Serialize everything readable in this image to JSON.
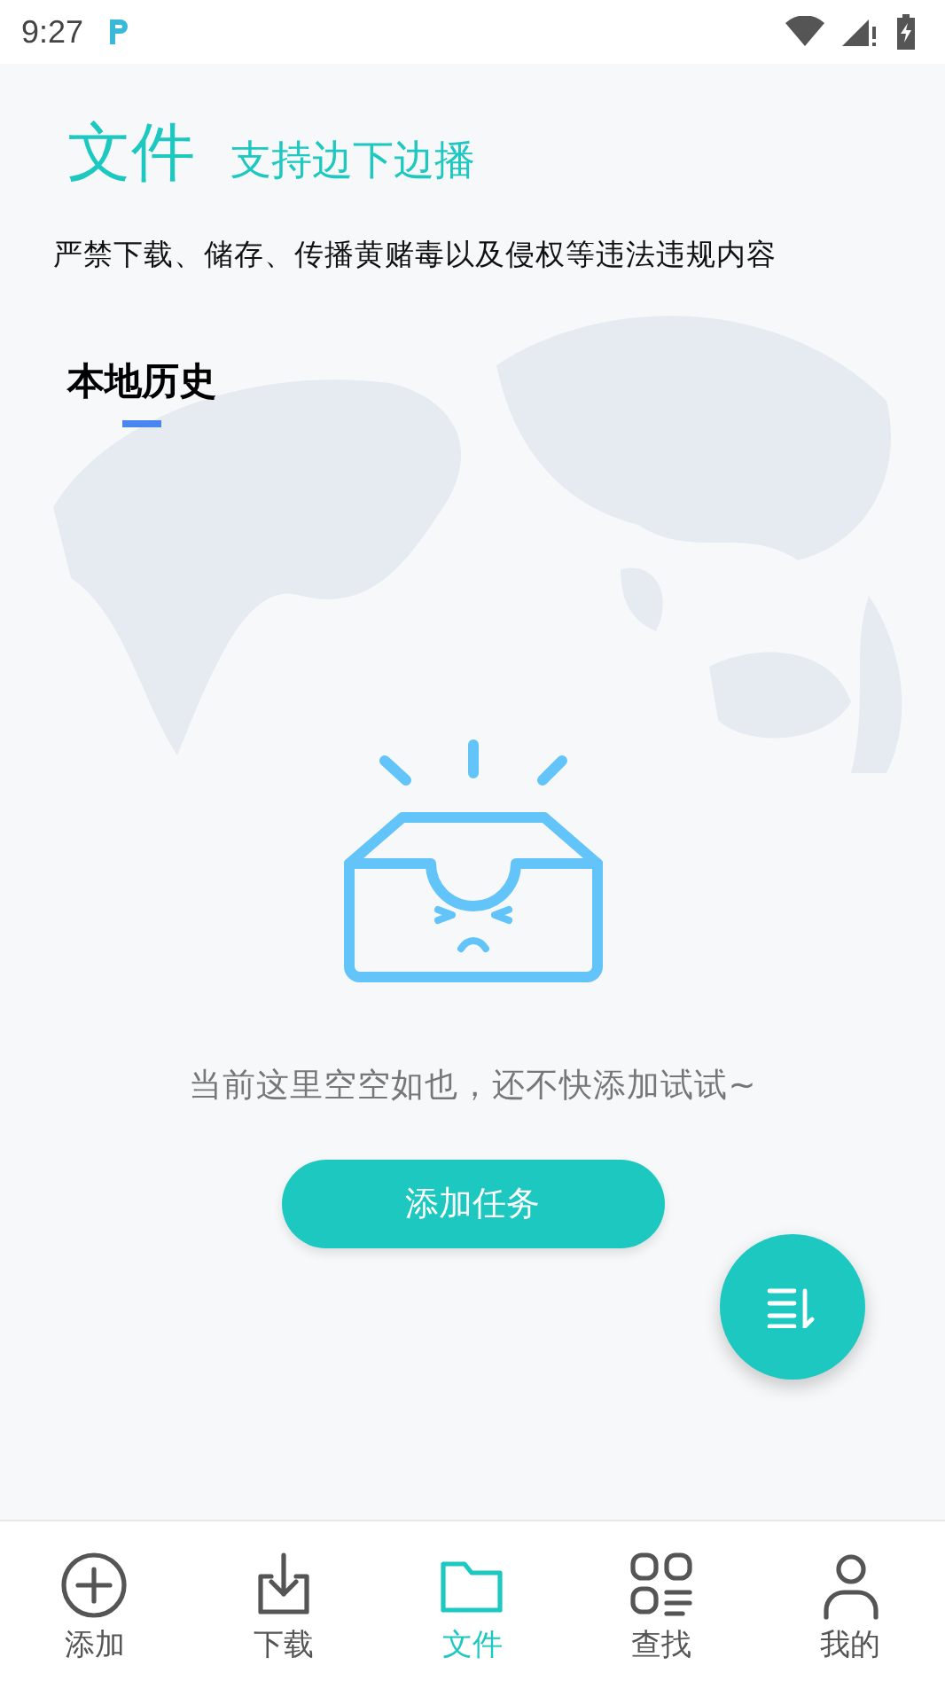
{
  "status_bar": {
    "time": "9:27"
  },
  "header": {
    "title": "文件",
    "subtitle": "支持边下边播"
  },
  "notice": "严禁下载、储存、传播黄赌毒以及侵权等违法违规内容",
  "tabs": [
    {
      "label": "本地历史",
      "selected": true
    }
  ],
  "empty_state": {
    "message": "当前这里空空如也，还不快添加试试~",
    "button": "添加任务"
  },
  "bottom_nav": [
    {
      "label": "添加",
      "selected": false
    },
    {
      "label": "下载",
      "selected": false
    },
    {
      "label": "文件",
      "selected": true
    },
    {
      "label": "查找",
      "selected": false
    },
    {
      "label": "我的",
      "selected": false
    }
  ]
}
